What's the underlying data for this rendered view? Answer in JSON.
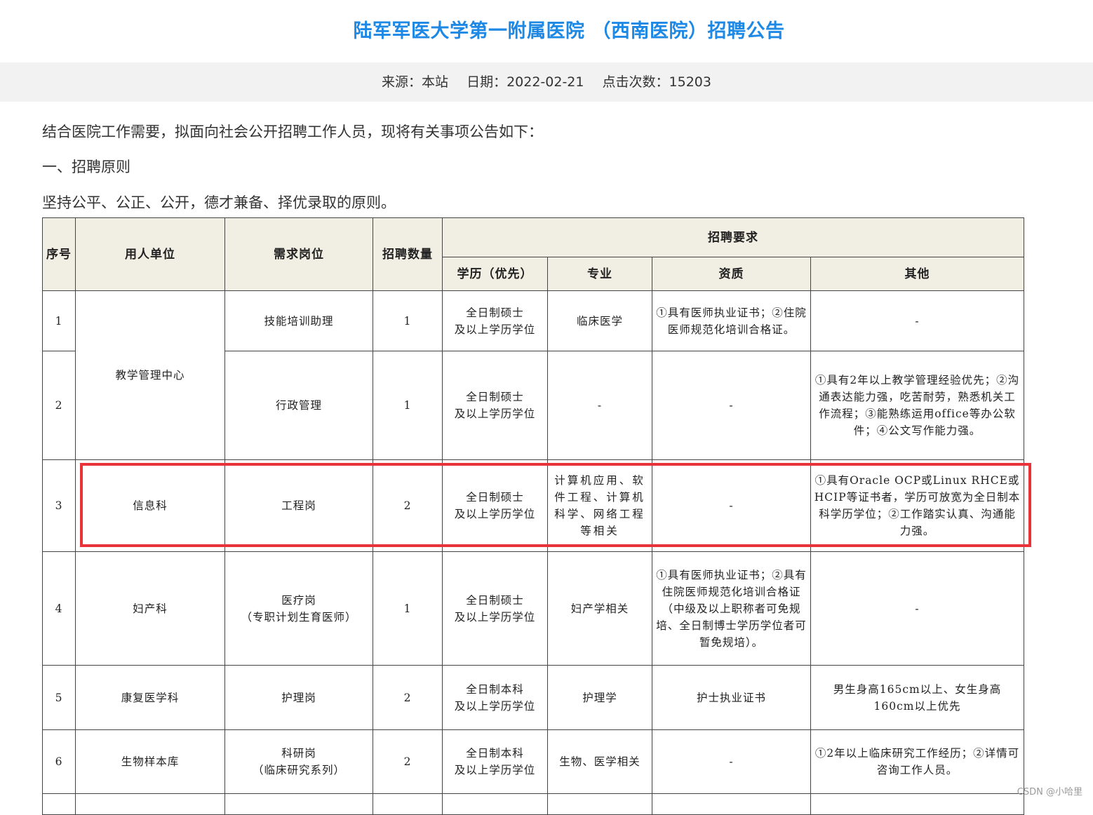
{
  "title": "陆军军医大学第一附属医院 （西南医院）招聘公告",
  "meta": {
    "source": "来源：本站",
    "date": "日期：2022-02-21",
    "clicks": "点击次数：15203"
  },
  "paragraphs": [
    "结合医院工作需要，拟面向社会公开招聘工作人员，现将有关事项公告如下：",
    "一、招聘原则",
    "坚持公平、公正、公开，德才兼备、择优录取的原则。"
  ],
  "table": {
    "headers": {
      "seq": "序号",
      "unit": "用人单位",
      "position": "需求岗位",
      "count": "招聘数量",
      "requirements": "招聘要求",
      "education": "学历（优先）",
      "major": "专业",
      "qualification": "资质",
      "other": "其他"
    },
    "rows": [
      {
        "seq": "1",
        "unit": "教学管理中心",
        "position": "技能培训助理",
        "position_sub": "",
        "count": "1",
        "education": "全日制硕士",
        "education_sub": "及以上学历学位",
        "major": "临床医学",
        "qualification": "①具有医师执业证书；②住院医师规范化培训合格证。",
        "other": "-"
      },
      {
        "seq": "2",
        "unit": "",
        "position": "行政管理",
        "position_sub": "",
        "count": "1",
        "education": "全日制硕士",
        "education_sub": "及以上学历学位",
        "major": "-",
        "qualification": "-",
        "other": "①具有2年以上教学管理经验优先；②沟通表达能力强，吃苦耐劳，熟悉机关工作流程；③能熟练运用office等办公软件；④公文写作能力强。"
      },
      {
        "seq": "3",
        "unit": "信息科",
        "position": "工程岗",
        "position_sub": "",
        "count": "2",
        "education": "全日制硕士",
        "education_sub": "及以上学历学位",
        "major": "计算机应用、软件工程、计算机科学、网络工程等相关",
        "qualification": "-",
        "other": "①具有Oracle OCP或Linux RHCE或HCIP等证书者，学历可放宽为全日制本科学历学位；②工作踏实认真、沟通能力强。"
      },
      {
        "seq": "4",
        "unit": "妇产科",
        "position": "医疗岗",
        "position_sub": "（专职计划生育医师）",
        "count": "1",
        "education": "全日制硕士",
        "education_sub": "及以上学历学位",
        "major": "妇产学相关",
        "qualification": "①具有医师执业证书；②具有住院医师规范化培训合格证（中级及以上职称者可免规培、全日制博士学历学位者可暂免规培）。",
        "other": "-"
      },
      {
        "seq": "5",
        "unit": "康复医学科",
        "position": "护理岗",
        "position_sub": "",
        "count": "2",
        "education": "全日制本科",
        "education_sub": "及以上学历学位",
        "major": "护理学",
        "qualification": "护士执业证书",
        "other": "男生身高165cm以上、女生身高160cm以上优先"
      },
      {
        "seq": "6",
        "unit": "生物样本库",
        "position": "科研岗",
        "position_sub": "（临床研究系列）",
        "count": "2",
        "education": "全日制本科",
        "education_sub": "及以上学历学位",
        "major": "生物、医学相关",
        "qualification": "-",
        "other": "①2年以上临床研究工作经历；②详情可咨询工作人员。"
      }
    ]
  },
  "watermark": "CSDN @小哈里"
}
